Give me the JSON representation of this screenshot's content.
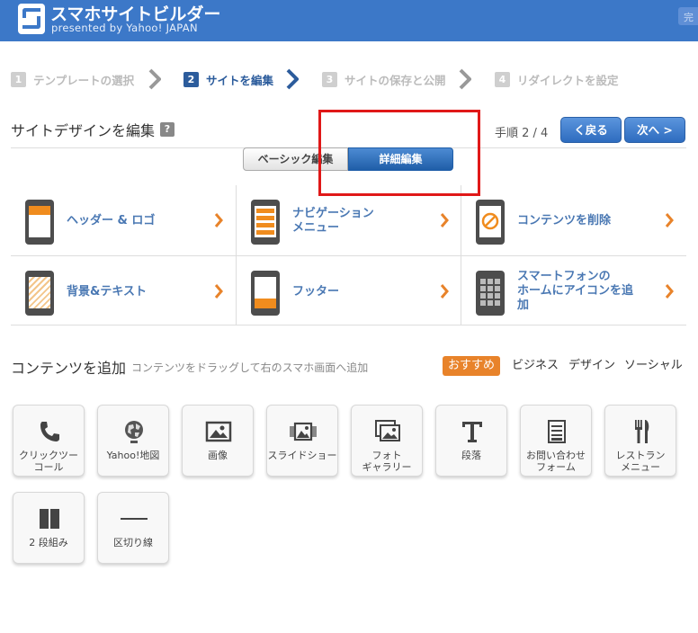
{
  "header": {
    "title": "スマホサイトビルダー",
    "subtitle": "presented by Yahoo! JAPAN",
    "right_text": "完"
  },
  "steps": [
    {
      "num": "1",
      "label": "テンプレートの選択",
      "active": false
    },
    {
      "num": "2",
      "label": "サイトを編集",
      "active": true
    },
    {
      "num": "3",
      "label": "サイトの保存と公開",
      "active": false
    },
    {
      "num": "4",
      "label": "リダイレクトを設定",
      "active": false
    }
  ],
  "page": {
    "title": "サイトデザインを編集",
    "help": "?",
    "step_count": "手順 2 / 4",
    "back_label": "く戻る",
    "next_label": "次へ >"
  },
  "tabs": {
    "basic": "ベーシック編集",
    "detail": "詳細編集"
  },
  "features": [
    {
      "label": "ヘッダー & ロゴ"
    },
    {
      "label": "ナビゲーション\nメニュー"
    },
    {
      "label": "コンテンツを削除"
    },
    {
      "label": "背景&テキスト"
    },
    {
      "label": "フッター"
    },
    {
      "label": "スマートフォンの\nホームにアイコンを追\n加"
    }
  ],
  "add_content": {
    "title": "コンテンツを追加",
    "subtitle": "コンテンツをドラッグして右のスマホ画面へ追加",
    "categories": [
      "おすすめ",
      "ビジネス",
      "デザイン",
      "ソーシャル"
    ],
    "selected_category": "おすすめ"
  },
  "tiles": [
    {
      "label": "クリックツー\nコール",
      "icon": "phone-icon"
    },
    {
      "label": "Yahoo!地図",
      "icon": "globe-icon"
    },
    {
      "label": "画像",
      "icon": "image-icon"
    },
    {
      "label": "スライドショー",
      "icon": "slideshow-icon"
    },
    {
      "label": "フォト\nギャラリー",
      "icon": "gallery-icon"
    },
    {
      "label": "段落",
      "icon": "text-icon"
    },
    {
      "label": "お問い合わせ\nフォーム",
      "icon": "form-icon"
    },
    {
      "label": "レストラン\nメニュー",
      "icon": "cutlery-icon"
    },
    {
      "label": "2 段組み",
      "icon": "two-column-icon"
    },
    {
      "label": "区切り線",
      "icon": "divider-icon"
    }
  ],
  "colors": {
    "brand": "#3c78c8",
    "active_step": "#2c5c9c",
    "feature_label": "#4a78b3",
    "accent_orange": "#e8832a",
    "highlight": "#e01818"
  }
}
